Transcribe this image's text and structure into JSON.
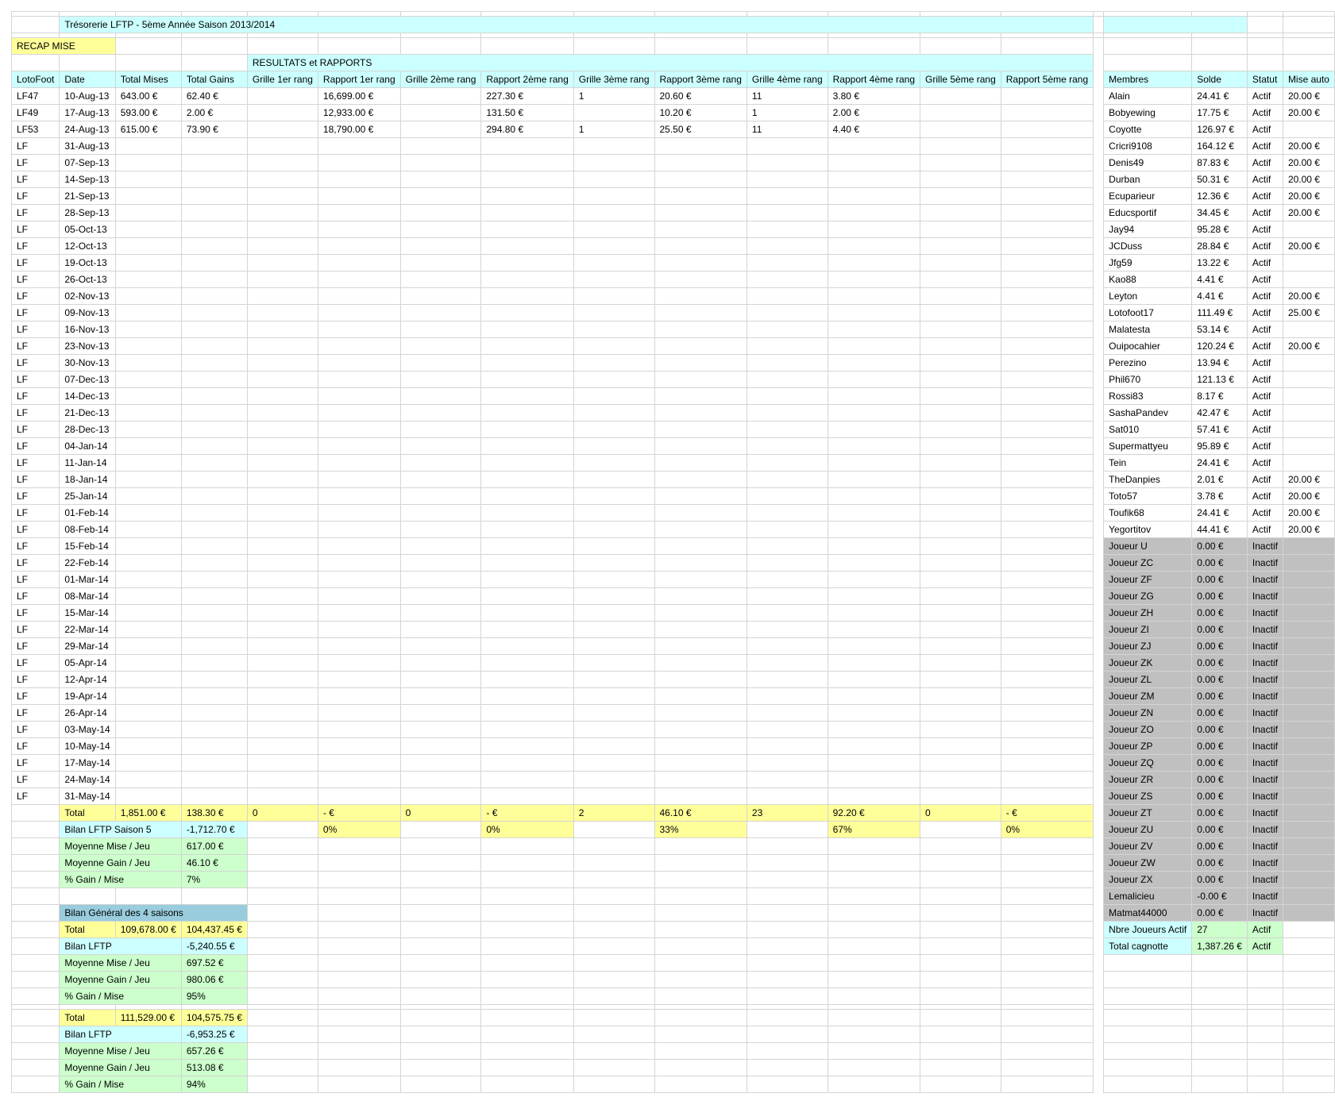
{
  "title": "Trésorerie LFTP - 5ème Année Saison 2013/2014",
  "recap_label": "RECAP MISE",
  "resultats_label": "RESULTATS et RAPPORTS",
  "headers": {
    "left": [
      "LotoFoot",
      "Date",
      "Total Mises",
      "Total Gains",
      "Grille 1er rang",
      "Rapport 1er rang",
      "Grille 2ème rang",
      "Rapport 2ème rang",
      "Grille 3ème rang",
      "Rapport 3ème rang",
      "Grille 4ème rang",
      "Rapport 4ème rang",
      "Grille 5ème rang",
      "Rapport 5ème rang"
    ],
    "right": [
      "Membres",
      "Solde",
      "Statut",
      "Mise auto"
    ]
  },
  "games": [
    [
      "LF47",
      "10-Aug-13",
      "643.00 €",
      "62.40 €",
      "",
      "16,699.00 €",
      "",
      "227.30 €",
      "1",
      "20.60 €",
      "11",
      "3.80 €",
      "",
      ""
    ],
    [
      "LF49",
      "17-Aug-13",
      "593.00 €",
      "2.00 €",
      "",
      "12,933.00 €",
      "",
      "131.50 €",
      "",
      "10.20 €",
      "1",
      "2.00 €",
      "",
      ""
    ],
    [
      "LF53",
      "24-Aug-13",
      "615.00 €",
      "73.90 €",
      "",
      "18,790.00 €",
      "",
      "294.80 €",
      "1",
      "25.50 €",
      "11",
      "4.40 €",
      "",
      ""
    ],
    [
      "LF",
      "31-Aug-13"
    ],
    [
      "LF",
      "07-Sep-13"
    ],
    [
      "LF",
      "14-Sep-13"
    ],
    [
      "LF",
      "21-Sep-13"
    ],
    [
      "LF",
      "28-Sep-13"
    ],
    [
      "LF",
      "05-Oct-13"
    ],
    [
      "LF",
      "12-Oct-13"
    ],
    [
      "LF",
      "19-Oct-13"
    ],
    [
      "LF",
      "26-Oct-13"
    ],
    [
      "LF",
      "02-Nov-13"
    ],
    [
      "LF",
      "09-Nov-13"
    ],
    [
      "LF",
      "16-Nov-13"
    ],
    [
      "LF",
      "23-Nov-13"
    ],
    [
      "LF",
      "30-Nov-13"
    ],
    [
      "LF",
      "07-Dec-13"
    ],
    [
      "LF",
      "14-Dec-13"
    ],
    [
      "LF",
      "21-Dec-13"
    ],
    [
      "LF",
      "28-Dec-13"
    ],
    [
      "LF",
      "04-Jan-14"
    ],
    [
      "LF",
      "11-Jan-14"
    ],
    [
      "LF",
      "18-Jan-14"
    ],
    [
      "LF",
      "25-Jan-14"
    ],
    [
      "LF",
      "01-Feb-14"
    ],
    [
      "LF",
      "08-Feb-14"
    ],
    [
      "LF",
      "15-Feb-14"
    ],
    [
      "LF",
      "22-Feb-14"
    ],
    [
      "LF",
      "01-Mar-14"
    ],
    [
      "LF",
      "08-Mar-14"
    ],
    [
      "LF",
      "15-Mar-14"
    ],
    [
      "LF",
      "22-Mar-14"
    ],
    [
      "LF",
      "29-Mar-14"
    ],
    [
      "LF",
      "05-Apr-14"
    ],
    [
      "LF",
      "12-Apr-14"
    ],
    [
      "LF",
      "19-Apr-14"
    ],
    [
      "LF",
      "26-Apr-14"
    ],
    [
      "LF",
      "03-May-14"
    ],
    [
      "LF",
      "10-May-14"
    ],
    [
      "LF",
      "17-May-14"
    ],
    [
      "LF",
      "24-May-14"
    ],
    [
      "LF",
      "31-May-14"
    ]
  ],
  "members": [
    [
      "Alain",
      "24.41 €",
      "Actif",
      "20.00 €"
    ],
    [
      "Bobyewing",
      "17.75 €",
      "Actif",
      "20.00 €"
    ],
    [
      "Coyotte",
      "126.97 €",
      "Actif",
      ""
    ],
    [
      "Cricri9108",
      "164.12 €",
      "Actif",
      "20.00 €"
    ],
    [
      "Denis49",
      "87.83 €",
      "Actif",
      "20.00 €"
    ],
    [
      "Durban",
      "50.31 €",
      "Actif",
      "20.00 €"
    ],
    [
      "Ecuparieur",
      "12.36 €",
      "Actif",
      "20.00 €"
    ],
    [
      "Educsportif",
      "34.45 €",
      "Actif",
      "20.00 €"
    ],
    [
      "Jay94",
      "95.28 €",
      "Actif",
      ""
    ],
    [
      "JCDuss",
      "28.84 €",
      "Actif",
      "20.00 €"
    ],
    [
      "Jfg59",
      "13.22 €",
      "Actif",
      ""
    ],
    [
      "Kao88",
      "4.41 €",
      "Actif",
      ""
    ],
    [
      "Leyton",
      "4.41 €",
      "Actif",
      "20.00 €"
    ],
    [
      "Lotofoot17",
      "111.49 €",
      "Actif",
      "25.00 €"
    ],
    [
      "Malatesta",
      "53.14 €",
      "Actif",
      ""
    ],
    [
      "Ouipocahier",
      "120.24 €",
      "Actif",
      "20.00 €"
    ],
    [
      "Perezino",
      "13.94 €",
      "Actif",
      ""
    ],
    [
      "Phil670",
      "121.13 €",
      "Actif",
      ""
    ],
    [
      "Rossi83",
      "8.17 €",
      "Actif",
      ""
    ],
    [
      "SashaPandev",
      "42.47 €",
      "Actif",
      ""
    ],
    [
      "Sat010",
      "57.41 €",
      "Actif",
      ""
    ],
    [
      "Supermattyeu",
      "95.89 €",
      "Actif",
      ""
    ],
    [
      "Tein",
      "24.41 €",
      "Actif",
      ""
    ],
    [
      "TheDanpies",
      "2.01 €",
      "Actif",
      "20.00 €"
    ],
    [
      "Toto57",
      "3.78 €",
      "Actif",
      "20.00 €"
    ],
    [
      "Toufik68",
      "24.41 €",
      "Actif",
      "20.00 €"
    ],
    [
      "Yegortitov",
      "44.41 €",
      "Actif",
      "20.00 €"
    ],
    [
      "Joueur U",
      "0.00 €",
      "Inactif",
      ""
    ],
    [
      "Joueur ZC",
      "0.00 €",
      "Inactif",
      ""
    ],
    [
      "Joueur ZF",
      "0.00 €",
      "Inactif",
      ""
    ],
    [
      "Joueur ZG",
      "0.00 €",
      "Inactif",
      ""
    ],
    [
      "Joueur ZH",
      "0.00 €",
      "Inactif",
      ""
    ],
    [
      "Joueur ZI",
      "0.00 €",
      "Inactif",
      ""
    ],
    [
      "Joueur ZJ",
      "0.00 €",
      "Inactif",
      ""
    ],
    [
      "Joueur ZK",
      "0.00 €",
      "Inactif",
      ""
    ],
    [
      "Joueur ZL",
      "0.00 €",
      "Inactif",
      ""
    ],
    [
      "Joueur ZM",
      "0.00 €",
      "Inactif",
      ""
    ],
    [
      "Joueur ZN",
      "0.00 €",
      "Inactif",
      ""
    ],
    [
      "Joueur ZO",
      "0.00 €",
      "Inactif",
      ""
    ],
    [
      "Joueur ZP",
      "0.00 €",
      "Inactif",
      ""
    ],
    [
      "Joueur ZQ",
      "0.00 €",
      "Inactif",
      ""
    ],
    [
      "Joueur ZR",
      "0.00 €",
      "Inactif",
      ""
    ],
    [
      "Joueur ZS",
      "0.00 €",
      "Inactif",
      ""
    ],
    [
      "Joueur ZT",
      "0.00 €",
      "Inactif",
      ""
    ],
    [
      "Joueur ZU",
      "0.00 €",
      "Inactif",
      ""
    ],
    [
      "Joueur ZV",
      "0.00 €",
      "Inactif",
      ""
    ],
    [
      "Joueur ZW",
      "0.00 €",
      "Inactif",
      ""
    ],
    [
      "Joueur ZX",
      "0.00 €",
      "Inactif",
      ""
    ],
    [
      "Lemalicieu",
      "-0.00 €",
      "Inactif",
      ""
    ],
    [
      "Matmat44000",
      "0.00 €",
      "Inactif",
      ""
    ]
  ],
  "totals_row": [
    "Total",
    "1,851.00 €",
    "138.30 €",
    "0",
    "- €",
    "0",
    "- €",
    "2",
    "46.10 €",
    "23",
    "92.20 €",
    "0",
    "- €"
  ],
  "bilan_saison_row": {
    "label": "Bilan LFTP Saison 5",
    "value": "-1,712.70 €",
    "pct": [
      "0%",
      "0%",
      "33%",
      "67%",
      "0%"
    ]
  },
  "season_stats": [
    {
      "label": "Moyenne Mise / Jeu",
      "value": "617.00 €"
    },
    {
      "label": "Moyenne Gain / Jeu",
      "value": "46.10 €"
    },
    {
      "label": "% Gain / Mise",
      "value": "7%"
    }
  ],
  "bilan_general_label": "Bilan Général des 4 saisons",
  "general_block_1": {
    "total_label": "Total",
    "total_mises": "109,678.00 €",
    "total_gains": "104,437.45 €",
    "bilan_label": "Bilan LFTP",
    "bilan_value": "-5,240.55 €",
    "stats": [
      {
        "label": "Moyenne Mise / Jeu",
        "value": "697.52 €"
      },
      {
        "label": "Moyenne Gain / Jeu",
        "value": "980.06 €"
      },
      {
        "label": "% Gain / Mise",
        "value": "95%"
      }
    ]
  },
  "general_block_2": {
    "total_label": "Total",
    "total_mises": "111,529.00 €",
    "total_gains": "104,575.75 €",
    "bilan_label": "Bilan LFTP",
    "bilan_value": "-6,953.25 €",
    "stats": [
      {
        "label": "Moyenne Mise / Jeu",
        "value": "657.26 €"
      },
      {
        "label": "Moyenne Gain / Jeu",
        "value": "513.08 €"
      },
      {
        "label": "% Gain / Mise",
        "value": "94%"
      }
    ]
  },
  "summary_right": [
    {
      "label": "Nbre Joueurs Actif",
      "value": "27",
      "status": "Actif"
    },
    {
      "label": "Total cagnotte",
      "value": "1,387.26 €",
      "status": "Actif"
    }
  ],
  "colors": {
    "cyan": "#ccffff",
    "yellow": "#ffff99",
    "green": "#ccffcc",
    "gray": "#c0c0c0",
    "blue": "#99ccdd"
  }
}
